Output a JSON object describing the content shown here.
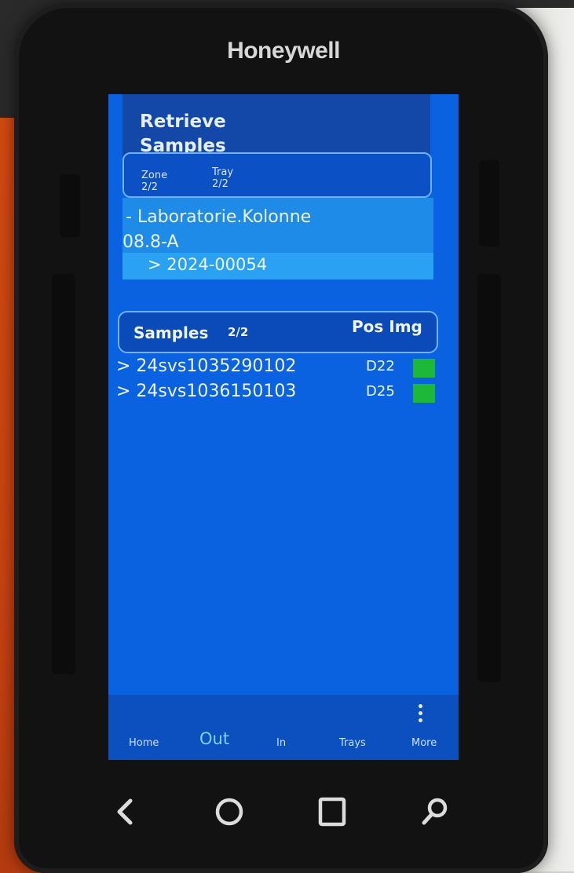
{
  "device": {
    "brand": "Honeywell"
  },
  "header": {
    "title_line1": "Retrieve",
    "title_line2": "Samples"
  },
  "zone_tray": {
    "zone_label": "Zone",
    "zone_value": "2/2",
    "tray_label": "Tray",
    "tray_value": "2/2"
  },
  "location": {
    "line1": "- Laboratorie.Kolonne",
    "line2": "08.8-A"
  },
  "order": {
    "text": "> 2024-00054"
  },
  "samples": {
    "label": "Samples",
    "count": "2/2",
    "pos_img_header": "Pos Img",
    "rows": [
      {
        "id": "> 24svs1035290102",
        "pos": "D22",
        "img_color": "#1db83a"
      },
      {
        "id": "> 24svs1036150103",
        "pos": "D25",
        "img_color": "#1db83a"
      }
    ]
  },
  "nav": {
    "home": "Home",
    "out": "Out",
    "in": "In",
    "trays": "Trays",
    "more": "More",
    "more_icon": "more-vertical-icon"
  },
  "system_nav": {
    "back_icon": "back-icon",
    "home_icon": "home-circle-icon",
    "recents_icon": "recents-square-icon",
    "search_icon": "search-icon"
  },
  "colors": {
    "screen_bg": "#0a62e0",
    "header_bg": "#1448a8",
    "location_bg": "#1f8be8",
    "order_bg": "#2aa1f2",
    "nav_active": "#7fd0ff",
    "status_ok": "#1db83a"
  }
}
